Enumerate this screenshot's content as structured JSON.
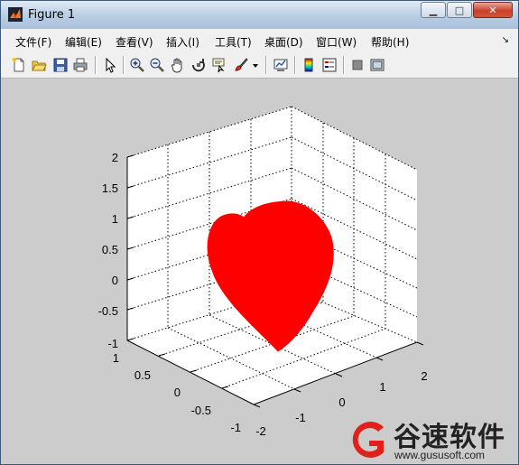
{
  "window": {
    "title": "Figure 1",
    "minimize": "▁",
    "maximize": "□",
    "close": "✕"
  },
  "menu": [
    "文件(F)",
    "编辑(E)",
    "查看(V)",
    "插入(I)",
    "工具(T)",
    "桌面(D)",
    "窗口(W)",
    "帮助(H)"
  ],
  "menu_overflow": "↘",
  "toolbar": [
    "new-figure-icon",
    "open-file-icon",
    "save-icon",
    "print-icon",
    "pointer-icon",
    "zoom-in-icon",
    "zoom-out-icon",
    "pan-hand-icon",
    "rotate-3d-icon",
    "data-cursor-icon",
    "brush-icon",
    "brush-dropdown-icon",
    "link-plot-icon",
    "colorbar-icon",
    "legend-icon",
    "hide-plot-tools-icon",
    "show-plot-tools-icon"
  ],
  "axes": {
    "z_ticks": [
      "2",
      "1.5",
      "1",
      "0.5",
      "0",
      "-0.5",
      "-1"
    ],
    "y_ticks": [
      "1",
      "0.5",
      "0",
      "-0.5",
      "-1"
    ],
    "x_ticks": [
      "-2",
      "-1",
      "0",
      "1",
      "2"
    ]
  },
  "surface": {
    "shape": "heart",
    "color": "#ff0000"
  },
  "watermark": {
    "text": "谷速软件",
    "url": "www.gususoft.com",
    "color": "#e0201b"
  }
}
